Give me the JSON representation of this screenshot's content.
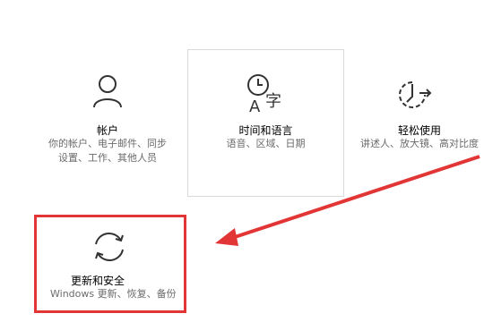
{
  "tiles": {
    "accounts": {
      "title": "帐户",
      "desc": "你的帐户、电子邮件、同步\n设置、工作、其他人员",
      "icon": "user-icon"
    },
    "time_language": {
      "title": "时间和语言",
      "desc": "语音、区域、日期",
      "icon": "time-language-icon"
    },
    "ease_of_access": {
      "title": "轻松使用",
      "desc": "讲述人、放大镜、高对比度",
      "icon": "timer-icon"
    },
    "update_security": {
      "title": "更新和安全",
      "desc": "Windows 更新、恢复、备份",
      "icon": "sync-icon"
    }
  },
  "colors": {
    "highlight": "#e23636",
    "text": "#000000",
    "secondary_text": "#6b6b6b"
  }
}
